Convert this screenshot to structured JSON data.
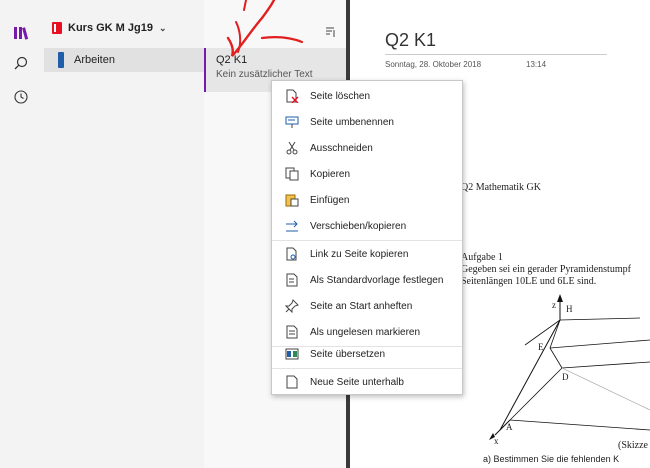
{
  "notebook": {
    "name": "Kurs GK M Jg19"
  },
  "sections": [
    {
      "label": "Arbeiten"
    }
  ],
  "pages": [
    {
      "title": "Q2 K1",
      "preview": "Kein zusätzlicher Text"
    }
  ],
  "page": {
    "title": "Q2 K1",
    "date": "Sonntag, 28. Oktober 2018",
    "time": "13:14"
  },
  "document": {
    "heading": "Q2  Mathematik GK",
    "task_title": "Aufgabe 1",
    "task_line1": "Gegeben sei ein gerader Pyramidenstumpf",
    "task_line2": "Seitenlängen 10LE und 6LE sind.",
    "labels": {
      "z": "z",
      "H": "H",
      "E": "E",
      "D": "D",
      "A": "A",
      "x": "x"
    },
    "caption": "(Skizze",
    "question_a": "a)   Bestimmen Sie die fehlenden K"
  },
  "context_menu": {
    "items": [
      {
        "label": "Seite löschen",
        "icon": "delete-page-icon"
      },
      {
        "label": "Seite umbenennen",
        "icon": "rename-page-icon"
      },
      {
        "label": "Ausschneiden",
        "icon": "scissors-icon"
      },
      {
        "label": "Kopieren",
        "icon": "copy-icon"
      },
      {
        "label": "Einfügen",
        "icon": "paste-icon"
      },
      {
        "label": "Verschieben/kopieren",
        "icon": "move-copy-icon"
      },
      {
        "label": "Link zu Seite kopieren",
        "icon": "link-icon"
      },
      {
        "label": "Als Standardvorlage festlegen",
        "icon": "template-icon"
      },
      {
        "label": "Seite an Start anheften",
        "icon": "pin-icon"
      },
      {
        "label": "Als ungelesen markieren",
        "icon": "unread-icon"
      },
      {
        "label": "Seite übersetzen",
        "icon": "translate-icon"
      },
      {
        "label": "Neue Seite unterhalb",
        "icon": "new-page-icon"
      }
    ]
  },
  "colors": {
    "accent": "#7719aa",
    "notebook": "#e81123",
    "section": "#1f5ea8",
    "ink": "#e02020"
  }
}
